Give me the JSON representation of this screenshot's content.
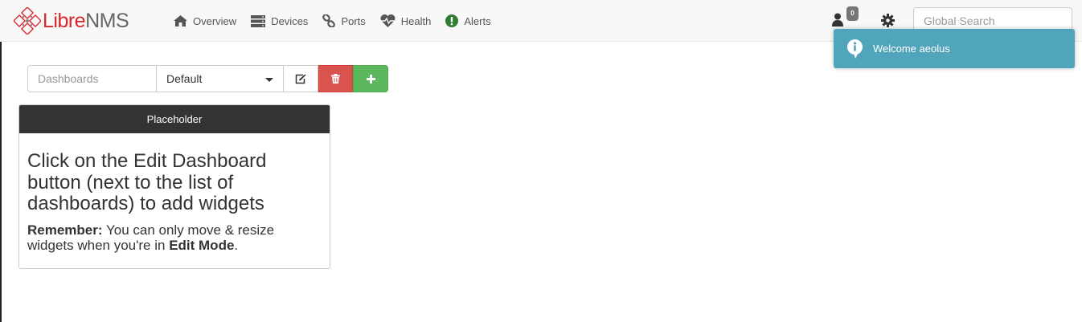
{
  "brand": {
    "part1": "Libre",
    "part2": "NMS"
  },
  "nav": {
    "items": [
      {
        "label": "Overview",
        "icon": "home-icon"
      },
      {
        "label": "Devices",
        "icon": "server-icon"
      },
      {
        "label": "Ports",
        "icon": "link-icon"
      },
      {
        "label": "Health",
        "icon": "heartbeat-icon"
      },
      {
        "label": "Alerts",
        "icon": "exclamation-circle-icon"
      }
    ],
    "notification_count": "0",
    "search_placeholder": "Global Search"
  },
  "toast": {
    "message": "Welcome aeolus"
  },
  "toolbar": {
    "dashboards_label": "Dashboards",
    "selected_dashboard": "Default"
  },
  "widget": {
    "title": "Placeholder",
    "heading": "Click on the Edit Dashboard button (next to the list of dashboards) to add widgets",
    "remember_label": "Remember:",
    "remember_text": " You can only move & resize widgets when you're in ",
    "edit_mode": "Edit Mode",
    "period": "."
  },
  "colors": {
    "brand_red": "#d9262c",
    "danger": "#d9534f",
    "success": "#5cb85c",
    "info": "#51a5bb",
    "widget_header": "#333333",
    "alert_green": "#2e7d32"
  }
}
